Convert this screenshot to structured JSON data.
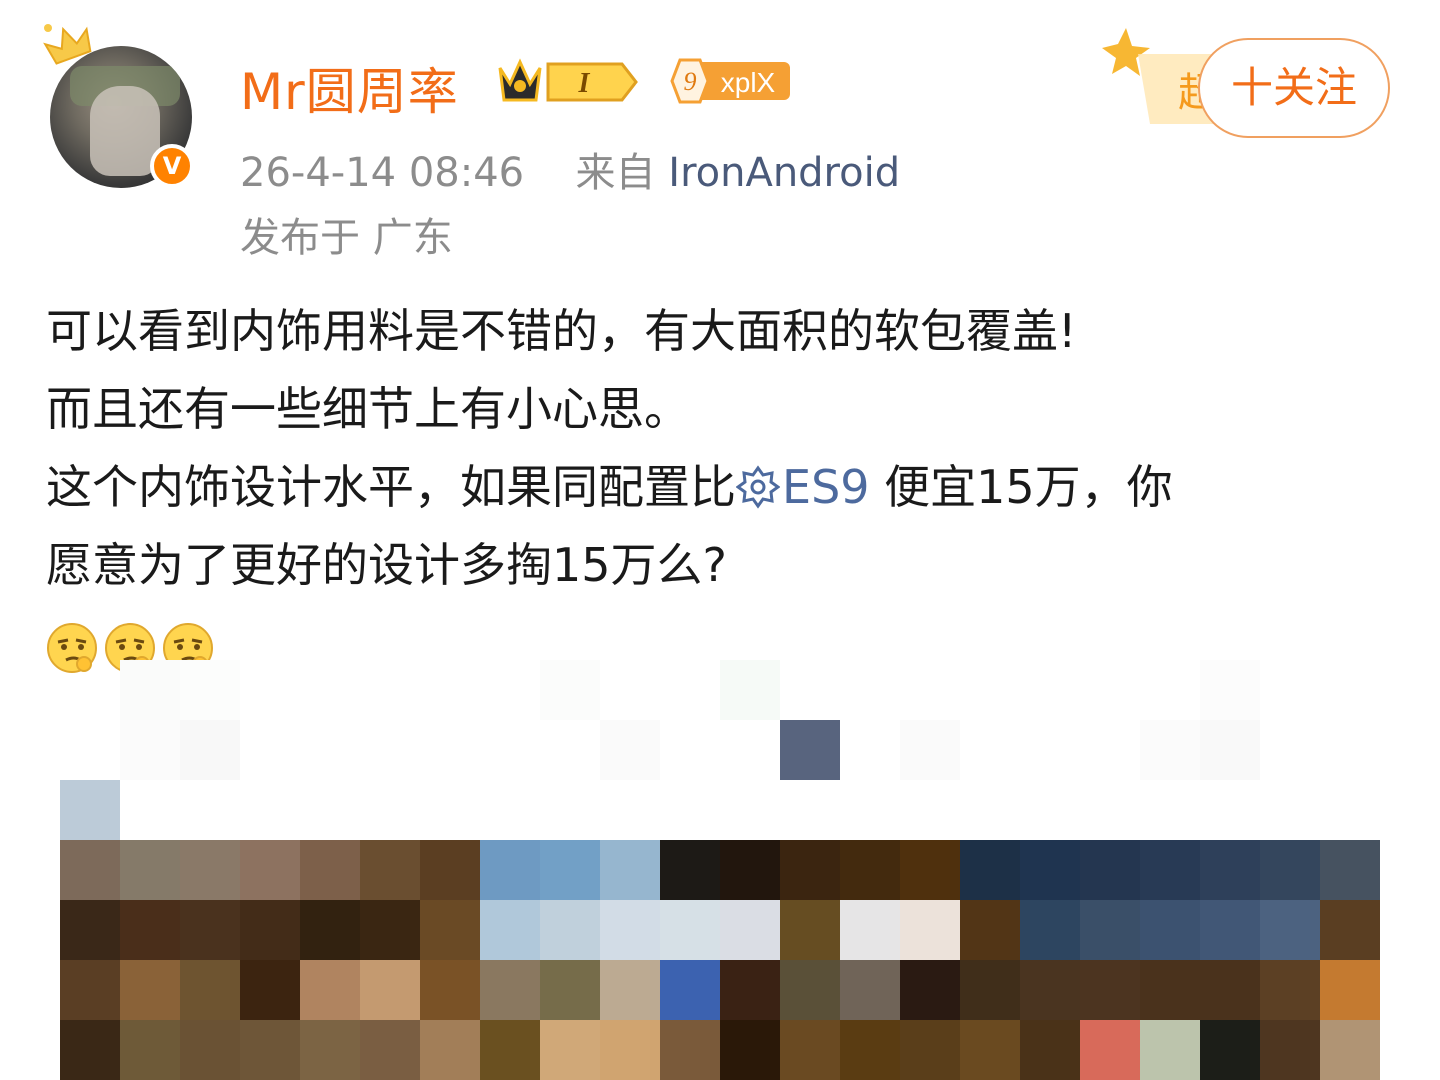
{
  "header": {
    "username": "Mr圆周率",
    "vip_level": "I",
    "level_number": "9",
    "level_label": "xplX",
    "timestamp": "26-4-14 08:46",
    "source_prefix": "来自",
    "source": "IronAndroid",
    "location": "发布于 广东",
    "super_badge_text": "超",
    "follow_label": "十关注",
    "verified_mark": "V"
  },
  "post": {
    "line1": "可以看到内饰用料是不错的，有大面积的软包覆盖!",
    "line2": "而且还有一些细节上有小心思。",
    "line3_before": "这个内饰设计水平，如果同配置比",
    "topic": "ES9",
    "line3_after": " 便宜15万，你",
    "line4": "愿意为了更好的设计多掏15万么?",
    "emoji_count_icons": [
      "thinking-face-icon",
      "thinking-face-icon",
      "thinking-face-icon"
    ]
  },
  "colors": {
    "username": "#f26d18",
    "meta": "#8c8c8c",
    "topic_link": "#4d6a9e",
    "follow_border": "#f0a060"
  },
  "image": {
    "description_icon": "pixelated-image-mosaic"
  }
}
